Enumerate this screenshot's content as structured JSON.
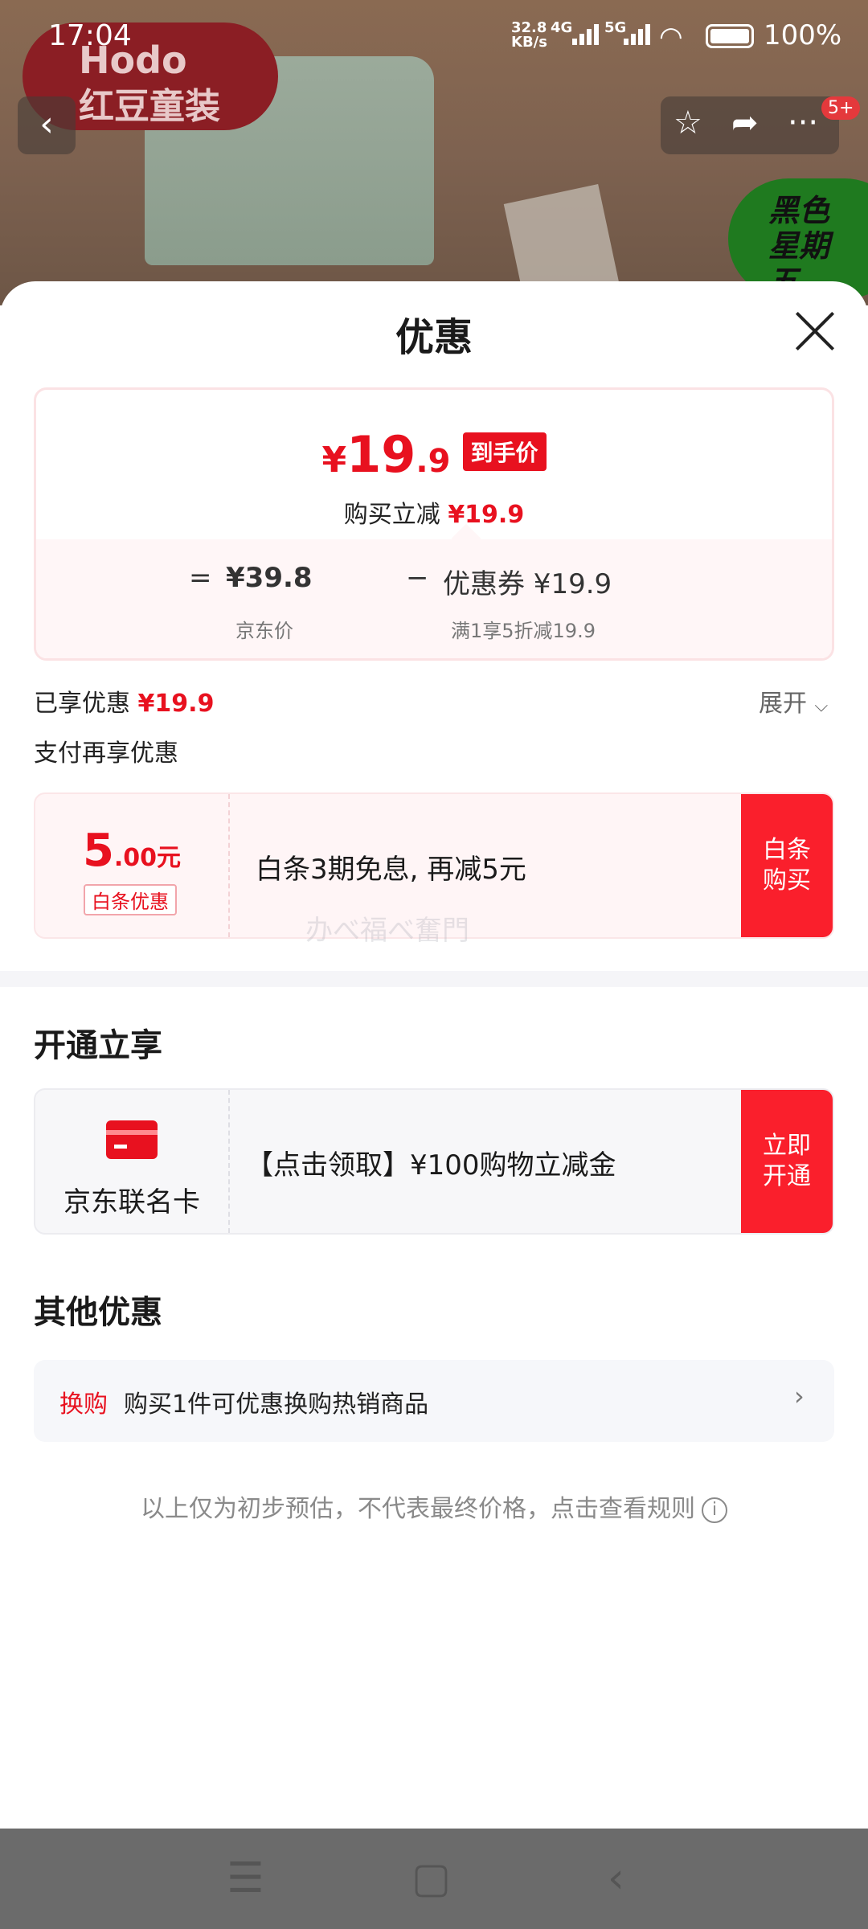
{
  "status_bar": {
    "time": "17:04",
    "speed": "32.8",
    "speed_unit": "KB/s",
    "net_4g": "4G",
    "net_5g": "5G",
    "battery": "100%"
  },
  "background": {
    "brand_name_en": "Hodo",
    "brand_name_cn": "红豆童装",
    "promo_badge": "黑色星期五",
    "message_badge": "5+"
  },
  "icons": {
    "back": "back-arrow-icon",
    "favorite": "star-icon",
    "share": "share-icon",
    "more": "more-icon",
    "close": "close-icon",
    "expand": "chevron-down-icon",
    "arrow": "chevron-right-icon",
    "info": "info-icon"
  },
  "sheet": {
    "title": "优惠",
    "final_price": {
      "yen": "¥",
      "int": "19",
      "dec": ".9",
      "tag": "到手价"
    },
    "instant_save_label": "购买立减",
    "instant_save_value": "¥19.9",
    "calc": {
      "eq": "=",
      "jd_price": "¥39.8",
      "minus": "−",
      "coupon": "优惠券 ¥19.9",
      "jd_price_label": "京东价",
      "coupon_desc": "满1享5折减19.9"
    },
    "enjoyed_label": "已享优惠",
    "enjoyed_value": "¥19.9",
    "expand_label": "展开",
    "pay_title": "支付再享优惠",
    "baitiao": {
      "amount_int": "5",
      "amount_dec": ".00元",
      "tag": "白条优惠",
      "desc": "白条3期免息, 再减5元",
      "button": "白条\n购买"
    },
    "watermark": "办べ福べ奮門",
    "open_title": "开通立享",
    "card": {
      "name": "京东联名卡",
      "desc": "【点击领取】¥100购物立减金",
      "button": "立即\n开通"
    },
    "other_title": "其他优惠",
    "swap": {
      "tag": "换购",
      "text": "购买1件可优惠换购热销商品"
    },
    "disclaimer": "以上仅为初步预估，不代表最终价格，点击查看规则"
  },
  "colors": {
    "accent_red": "#e8111f",
    "button_red": "#fa1f2c"
  }
}
